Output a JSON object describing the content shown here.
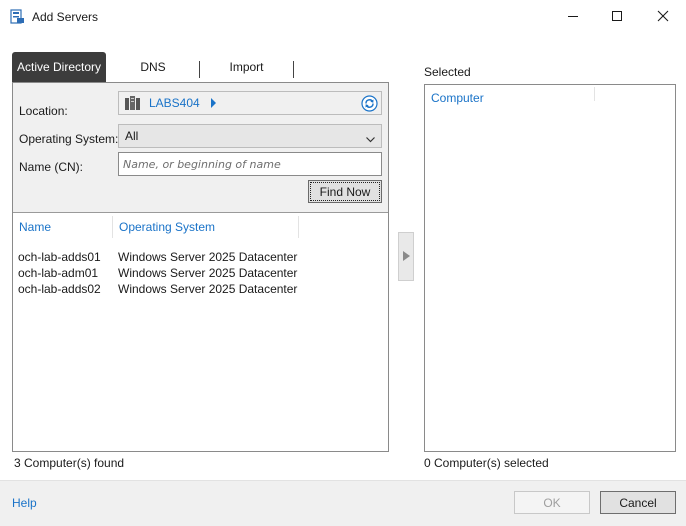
{
  "window": {
    "title": "Add Servers",
    "icons": {
      "app": "server-manager-icon",
      "minimize": "minimize-icon",
      "maximize": "maximize-icon",
      "close": "close-icon"
    }
  },
  "tabs": [
    {
      "label": "Active Directory",
      "active": true
    },
    {
      "label": "DNS",
      "active": false
    },
    {
      "label": "Import",
      "active": false
    }
  ],
  "search": {
    "location_label": "Location:",
    "location_value": "LABS404",
    "os_label": "Operating System:",
    "os_value": "All",
    "name_label": "Name (CN):",
    "name_placeholder": "Name, or beginning of name",
    "name_value": "",
    "find_now_label": "Find Now"
  },
  "results": {
    "columns": [
      "Name",
      "Operating System"
    ],
    "rows": [
      {
        "name": "och-lab-adds01",
        "os": "Windows Server 2025 Datacenter"
      },
      {
        "name": "och-lab-adm01",
        "os": "Windows Server 2025 Datacenter"
      },
      {
        "name": "och-lab-adds02",
        "os": "Windows Server 2025 Datacenter"
      }
    ],
    "found_text": "3 Computer(s) found"
  },
  "selected": {
    "title": "Selected",
    "column": "Computer",
    "count_text": "0 Computer(s) selected"
  },
  "footer": {
    "help_label": "Help",
    "ok_label": "OK",
    "ok_enabled": false,
    "cancel_label": "Cancel"
  },
  "colors": {
    "accent": "#1a73c8",
    "active_tab": "#3c3c3c",
    "panel_bg": "#f0f0f0"
  }
}
